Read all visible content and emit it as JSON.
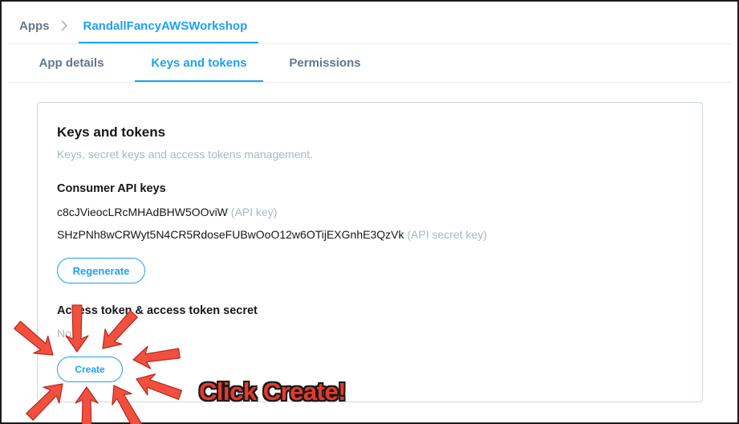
{
  "breadcrumb": {
    "root": "Apps",
    "current": "RandallFancyAWSWorkshop"
  },
  "tabs": [
    {
      "label": "App details",
      "active": false
    },
    {
      "label": "Keys and tokens",
      "active": true
    },
    {
      "label": "Permissions",
      "active": false
    }
  ],
  "card": {
    "title": "Keys and tokens",
    "subtitle": "Keys, secret keys and access tokens management.",
    "consumer": {
      "heading": "Consumer API keys",
      "api_key": "c8cJVieocLRcMHAdBHW5OOviW",
      "api_key_hint": "(API key)",
      "api_secret": "SHzPNh8wCRWyt5N4CR5RdoseFUBwOoO12w6OTijEXGnhE3QzVk",
      "api_secret_hint": "(API secret key)",
      "regenerate_label": "Regenerate"
    },
    "access": {
      "heading": "Access token & access token secret",
      "empty_text": "No",
      "create_label": "Create"
    }
  },
  "annotation": {
    "callout_text": "Click Create!",
    "arrow_color": "#f1503f",
    "text_color": "#e8392b"
  },
  "colors": {
    "accent": "#1da1f2",
    "muted": "#aab8c2",
    "secondary": "#657786"
  }
}
